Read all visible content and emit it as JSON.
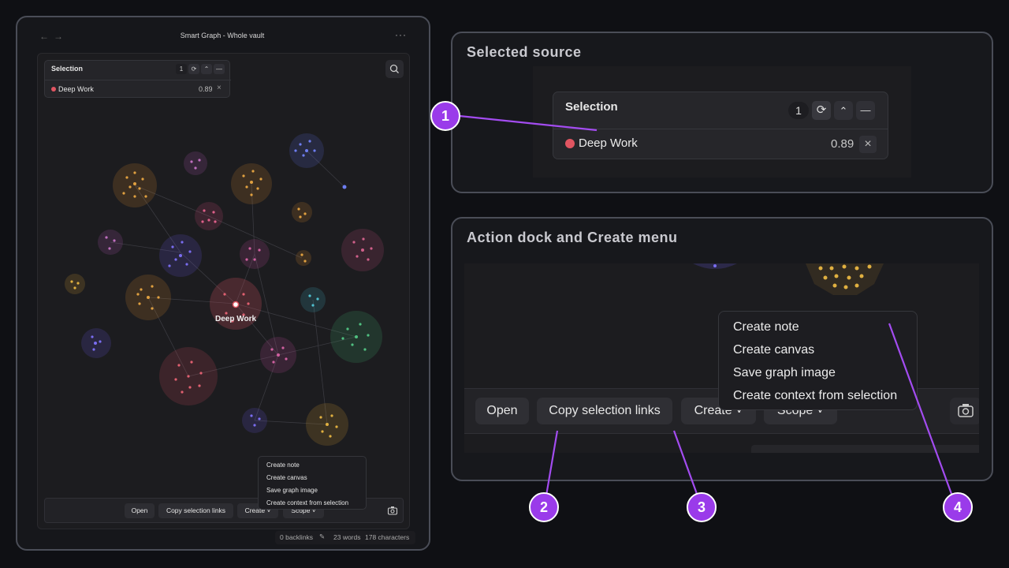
{
  "window": {
    "title": "Smart Graph - Whole vault",
    "more_label": "···"
  },
  "selection": {
    "title": "Selection",
    "count": "1",
    "item_name": "Deep Work",
    "item_score": "0.89",
    "color": "#e05561"
  },
  "graph": {
    "node_label": "Deep Work"
  },
  "menu": {
    "items": [
      "Create note",
      "Create canvas",
      "Save graph image",
      "Create context from selection"
    ]
  },
  "dock": {
    "open": "Open",
    "copy_links": "Copy selection links",
    "create": "Create",
    "scope": "Scope"
  },
  "status": {
    "backlinks": "0 backlinks",
    "words": "23 words",
    "characters": "178 characters"
  },
  "callouts": {
    "selected_source": {
      "title": "Selected source"
    },
    "action_dock": {
      "title": "Action dock and Create menu"
    }
  },
  "badges": [
    "1",
    "2",
    "3",
    "4"
  ],
  "colors": {
    "accent": "#9a3bea",
    "selection_dot": "#e05561"
  }
}
